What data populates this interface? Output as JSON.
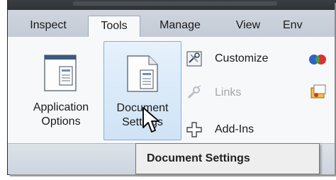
{
  "tabs": [
    "Inspect",
    "Tools",
    "Manage",
    "View",
    "Env"
  ],
  "active_tab": "Tools",
  "ribbon": {
    "application_options": {
      "line1": "Application",
      "line2": "Options"
    },
    "document_settings": {
      "line1": "Document",
      "line2": "Settings"
    },
    "small_buttons": {
      "customize": "Customize",
      "links": "Links",
      "add_ins": "Add-Ins"
    }
  },
  "tooltip": {
    "text": "Document Settings"
  },
  "icons": {
    "customize": "customize-icon",
    "links": "links-icon",
    "add_ins": "add-ins-icon",
    "cursor": "mouse-pointer-icon"
  }
}
